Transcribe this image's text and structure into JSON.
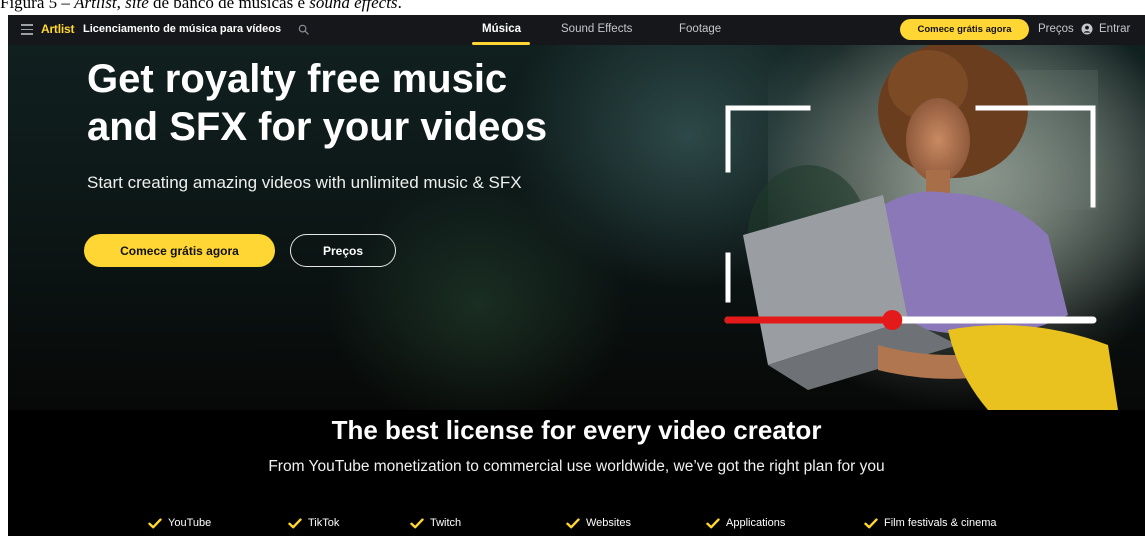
{
  "caption": {
    "prefix": "Figura 5 – ",
    "brand": "Artlist",
    "middle": ", ",
    "site_word": "site",
    "rest": " de banco de músicas e ",
    "sound_effects": "sound effects",
    "end": "."
  },
  "nav": {
    "logo": "Artlist",
    "brand_title": "Licenciamento de música para vídeos",
    "tabs": [
      "Música",
      "Sound Effects",
      "Footage"
    ],
    "active_tab": "Música",
    "cta": "Comece grátis agora",
    "pricing": "Preços",
    "login": "Entrar",
    "icons": [
      "hamburger-icon",
      "search-icon",
      "user-icon"
    ]
  },
  "hero": {
    "title_line1": "Get royalty free music",
    "title_line2": "and SFX for your videos",
    "subtitle": "Start creating amazing videos with unlimited music & SFX",
    "cta": "Comece grátis agora",
    "secondary": "Preços",
    "progress": 0.45
  },
  "license": {
    "title": "The best license for every video creator",
    "subtitle": "From YouTube monetization to commercial use worldwide, we’ve got the right plan for you",
    "features": [
      "YouTube",
      "TikTok",
      "Twitch",
      "Websites",
      "Applications",
      "Film festivals & cinema"
    ]
  },
  "colors": {
    "accent": "#ffd633",
    "nav_bg": "#16171a",
    "progress_red": "#e41a1a"
  }
}
